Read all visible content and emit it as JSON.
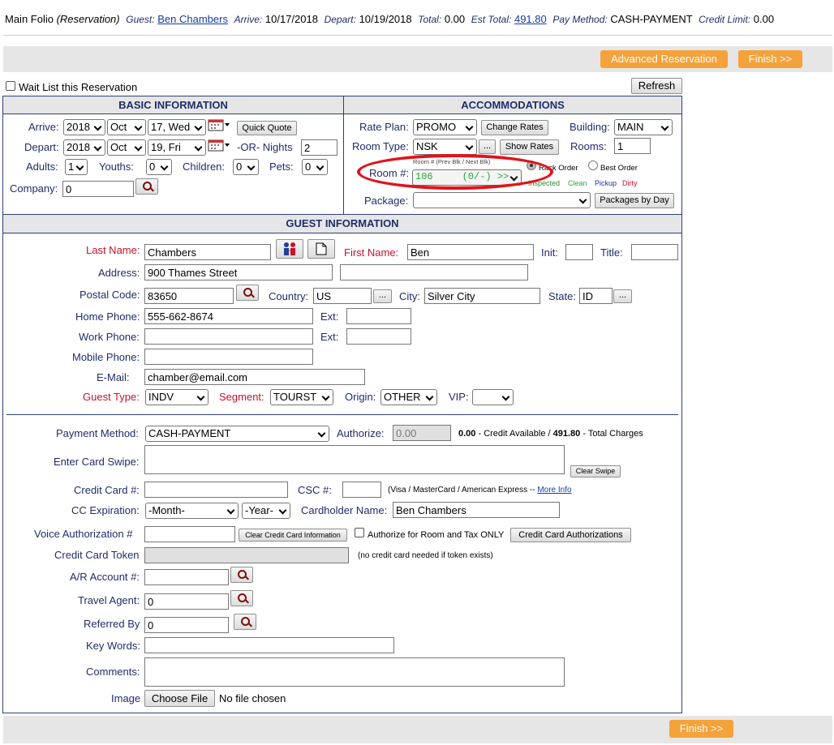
{
  "header": {
    "title": "Main Folio",
    "mode": "(Reservation)",
    "guest_label": "Guest:",
    "guest_name": "Ben Chambers",
    "arrive_label": "Arrive:",
    "arrive": "10/17/2018",
    "depart_label": "Depart:",
    "depart": "10/19/2018",
    "total_label": "Total:",
    "total": "0.00",
    "est_total_label": "Est Total:",
    "est_total": "491.80",
    "pay_method_label": "Pay Method:",
    "pay_method": "CASH-PAYMENT",
    "credit_limit_label": "Credit Limit:",
    "credit_limit": "0.00"
  },
  "toolbar": {
    "advanced_label": "Advanced Reservation",
    "finish_label": "Finish >>"
  },
  "waitlist_label": "Wait List this Reservation",
  "refresh_label": "Refresh",
  "basic": {
    "heading": "BASIC INFORMATION",
    "arrive_label": "Arrive:",
    "arrive_year": "2018",
    "arrive_month": "Oct",
    "arrive_day": "17, Wed",
    "depart_label": "Depart:",
    "depart_year": "2018",
    "depart_month": "Oct",
    "depart_day": "19, Fri",
    "nights_label": "-OR- Nights",
    "nights": "2",
    "quick_quote_label": "Quick Quote",
    "adults_label": "Adults:",
    "adults": "1",
    "youths_label": "Youths:",
    "youths": "0",
    "children_label": "Children:",
    "children": "0",
    "pets_label": "Pets:",
    "pets": "0",
    "company_label": "Company:",
    "company": "0"
  },
  "accom": {
    "heading": "ACCOMMODATIONS",
    "rate_plan_label": "Rate Plan:",
    "rate_plan": "PROMO",
    "change_rates_label": "Change Rates",
    "building_label": "Building:",
    "building": "MAIN",
    "room_type_label": "Room Type:",
    "room_type": "NSK",
    "dots_label": "...",
    "show_rates_label": "Show Rates",
    "rooms_label": "Rooms:",
    "rooms": "1",
    "room_no_label": "Room #:",
    "room_hint": "Room # (Prev Blk / Next Blk)",
    "room_value": "106     (0/-) >>",
    "rack_order_label": "Rack Order",
    "best_order_label": "Best Order",
    "legend_inspected": "Inspected",
    "legend_clean": "Clean",
    "legend_pickup": "Pickup",
    "legend_dirty": "Dirty",
    "package_label": "Package:",
    "package": "",
    "packages_by_day_label": "Packages by Day"
  },
  "guest": {
    "heading": "GUEST INFORMATION",
    "last_name_label": "Last Name:",
    "last_name": "Chambers",
    "first_name_label": "First Name:",
    "first_name": "Ben",
    "init_label": "Init:",
    "title_label": "Title:",
    "address_label": "Address:",
    "address1": "900 Thames Street",
    "address2": "",
    "postal_label": "Postal Code:",
    "postal": "83650",
    "country_label": "Country:",
    "country": "US",
    "city_label": "City:",
    "city": "Silver City",
    "state_label": "State:",
    "state": "ID",
    "home_phone_label": "Home Phone:",
    "home_phone": "555-662-8674",
    "ext_label": "Ext:",
    "work_phone_label": "Work Phone:",
    "work_phone": "",
    "mobile_phone_label": "Mobile Phone:",
    "mobile_phone": "",
    "email_label": "E-Mail:",
    "email": "chamber@email.com",
    "guest_type_label": "Guest Type:",
    "guest_type": "INDV",
    "segment_label": "Segment:",
    "segment": "TOURST",
    "origin_label": "Origin:",
    "origin": "OTHER",
    "vip_label": "VIP:",
    "vip": ""
  },
  "payment": {
    "method_label": "Payment Method:",
    "method": "CASH-PAYMENT",
    "authorize_label": "Authorize:",
    "authorize": "0.00",
    "credit_available_value": "0.00",
    "credit_available_text": "- Credit Available  /",
    "total_charges_value": "491.80",
    "total_charges_text": "- Total Charges",
    "swipe_label": "Enter Card Swipe:",
    "clear_swipe_label": "Clear Swipe",
    "card_label": "Credit Card #:",
    "csc_label": "CSC #:",
    "card_types": "(Visa / MasterCard / American Express --",
    "more_info": "More Info",
    "expiration_label": "CC Expiration:",
    "exp_month": "-Month-",
    "exp_year": "-Year-",
    "cardholder_label": "Cardholder Name:",
    "cardholder": "Ben Chambers",
    "voice_label": "Voice Authorization #",
    "clear_cc_label": "Clear Credit Card Information",
    "auth_room_tax_label": "Authorize for Room and Tax ONLY",
    "cc_auth_label": "Credit Card Authorizations",
    "token_label": "Credit Card Token",
    "token_note": "(no credit card needed if token exists)",
    "ar_label": "A/R Account #:",
    "ar": "",
    "travel_label": "Travel Agent:",
    "travel": "0",
    "referred_label": "Referred By",
    "referred": "0",
    "keywords_label": "Key Words:",
    "comments_label": "Comments:",
    "image_label": "Image",
    "choose_file_label": "Choose File",
    "no_file": "No file chosen"
  },
  "colors": {
    "accent": "#f5a23a",
    "navy": "#1f2d6b",
    "required": "#c8102e",
    "highlight_ring": "#e0141b"
  }
}
